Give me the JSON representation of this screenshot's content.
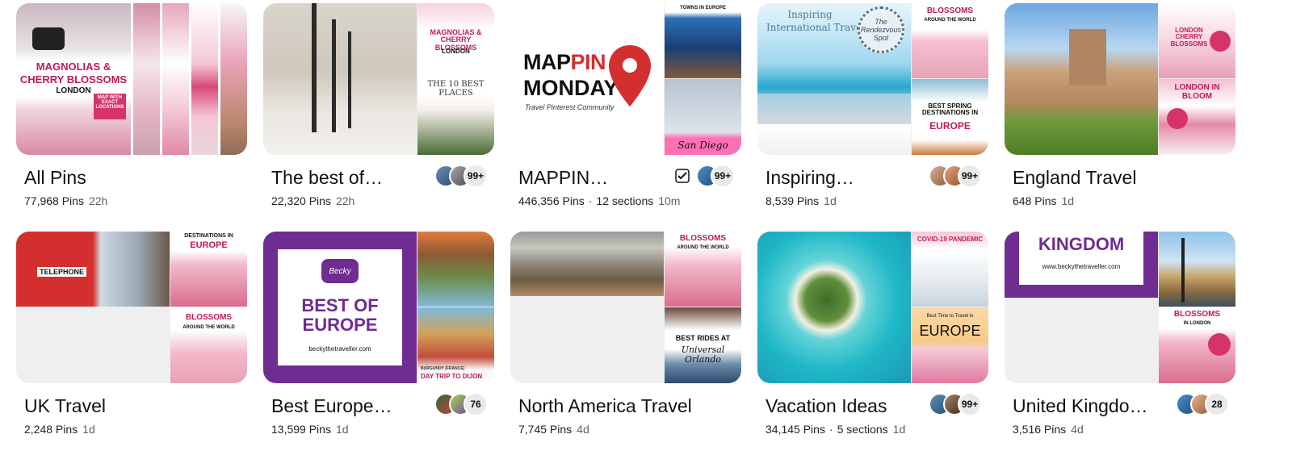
{
  "boards": [
    {
      "title": "All Pins",
      "pins": "77,968 Pins",
      "time": "22h",
      "sections": "",
      "count": "",
      "overlay": {
        "l1": "MAGNOLIAS &",
        "l2": "CHERRY BLOSSOMS",
        "l3": "LONDON",
        "badge": "MAP WITH EXACT LOCATIONS"
      }
    },
    {
      "title": "The best of…",
      "pins": "22,320 Pins",
      "time": "22h",
      "sections": "",
      "count": "99+",
      "overlay": {
        "r1": "MAGNOLIAS & CHERRY BLOSSOMS",
        "r2": "LONDON",
        "r3": "THE 10 BEST PLACES"
      }
    },
    {
      "title": "MAPPIN…",
      "pins": "446,356 Pins",
      "time": "10m",
      "sections": "12 sections",
      "count": "99+",
      "overlay": {
        "m1": "MAPPIN",
        "m1a": "MAP",
        "m1b": "PIN",
        "m2": "MONDAY",
        "m3": "Travel Pinterest Community",
        "r1": "TOWNS IN EUROPE",
        "r2": "San Diego"
      }
    },
    {
      "title": "Inspiring…",
      "pins": "8,539 Pins",
      "time": "1d",
      "sections": "",
      "count": "99+",
      "overlay": {
        "l1": "Inspiring",
        "l2": "International Travel",
        "seal": "The Rendezvous Spot",
        "r1": "BLOSSOMS",
        "r1b": "AROUND THE WORLD",
        "r2": "BEST SPRING DESTINATIONS IN",
        "r3": "EUROPE"
      }
    },
    {
      "title": "England Travel",
      "pins": "648 Pins",
      "time": "1d",
      "sections": "",
      "count": "",
      "overlay": {
        "r1": "LONDON CHERRY BLOSSOMS",
        "r2": "LONDON IN BLOOM"
      }
    },
    {
      "title": "UK Travel",
      "pins": "2,248 Pins",
      "time": "1d",
      "sections": "",
      "count": "",
      "overlay": {
        "l1": "TELEPHONE",
        "r1": "DESTINATIONS IN",
        "r1b": "EUROPE",
        "r2": "BLOSSOMS",
        "r2b": "AROUND THE WORLD"
      }
    },
    {
      "title": "Best Europe…",
      "pins": "13,599 Pins",
      "time": "1d",
      "sections": "",
      "count": "76",
      "overlay": {
        "brand": "Becky",
        "l1": "BEST OF",
        "l2": "EUROPE",
        "l3": "beckythetraveller.com",
        "r1": "BURGUNDY (FRANCE)",
        "r2": "DAY TRIP TO DIJON"
      }
    },
    {
      "title": "North America Travel",
      "pins": "7,745 Pins",
      "time": "4d",
      "sections": "",
      "count": "",
      "overlay": {
        "r1": "BLOSSOMS",
        "r1b": "AROUND THE WORLD",
        "r2": "BEST RIDES AT",
        "r3": "Universal Orlando"
      }
    },
    {
      "title": "Vacation Ideas",
      "pins": "34,145 Pins",
      "time": "1d",
      "sections": "5 sections",
      "count": "99+",
      "overlay": {
        "r1": "COVID-19 PANDEMIC",
        "r2": "Best Time to Travel in",
        "r3": "EUROPE"
      }
    },
    {
      "title": "United Kingdo…",
      "pins": "3,516 Pins",
      "time": "4d",
      "sections": "",
      "count": "28",
      "overlay": {
        "l1": "KINGDOM",
        "l2": "www.beckythetraveller.com",
        "r1": "BLOSSOMS",
        "r1b": "IN LONDON"
      }
    }
  ],
  "colors": {
    "pink": "#d6336c",
    "purple": "#6f2c91",
    "red": "#d32f2f",
    "grey": "#efefef"
  }
}
